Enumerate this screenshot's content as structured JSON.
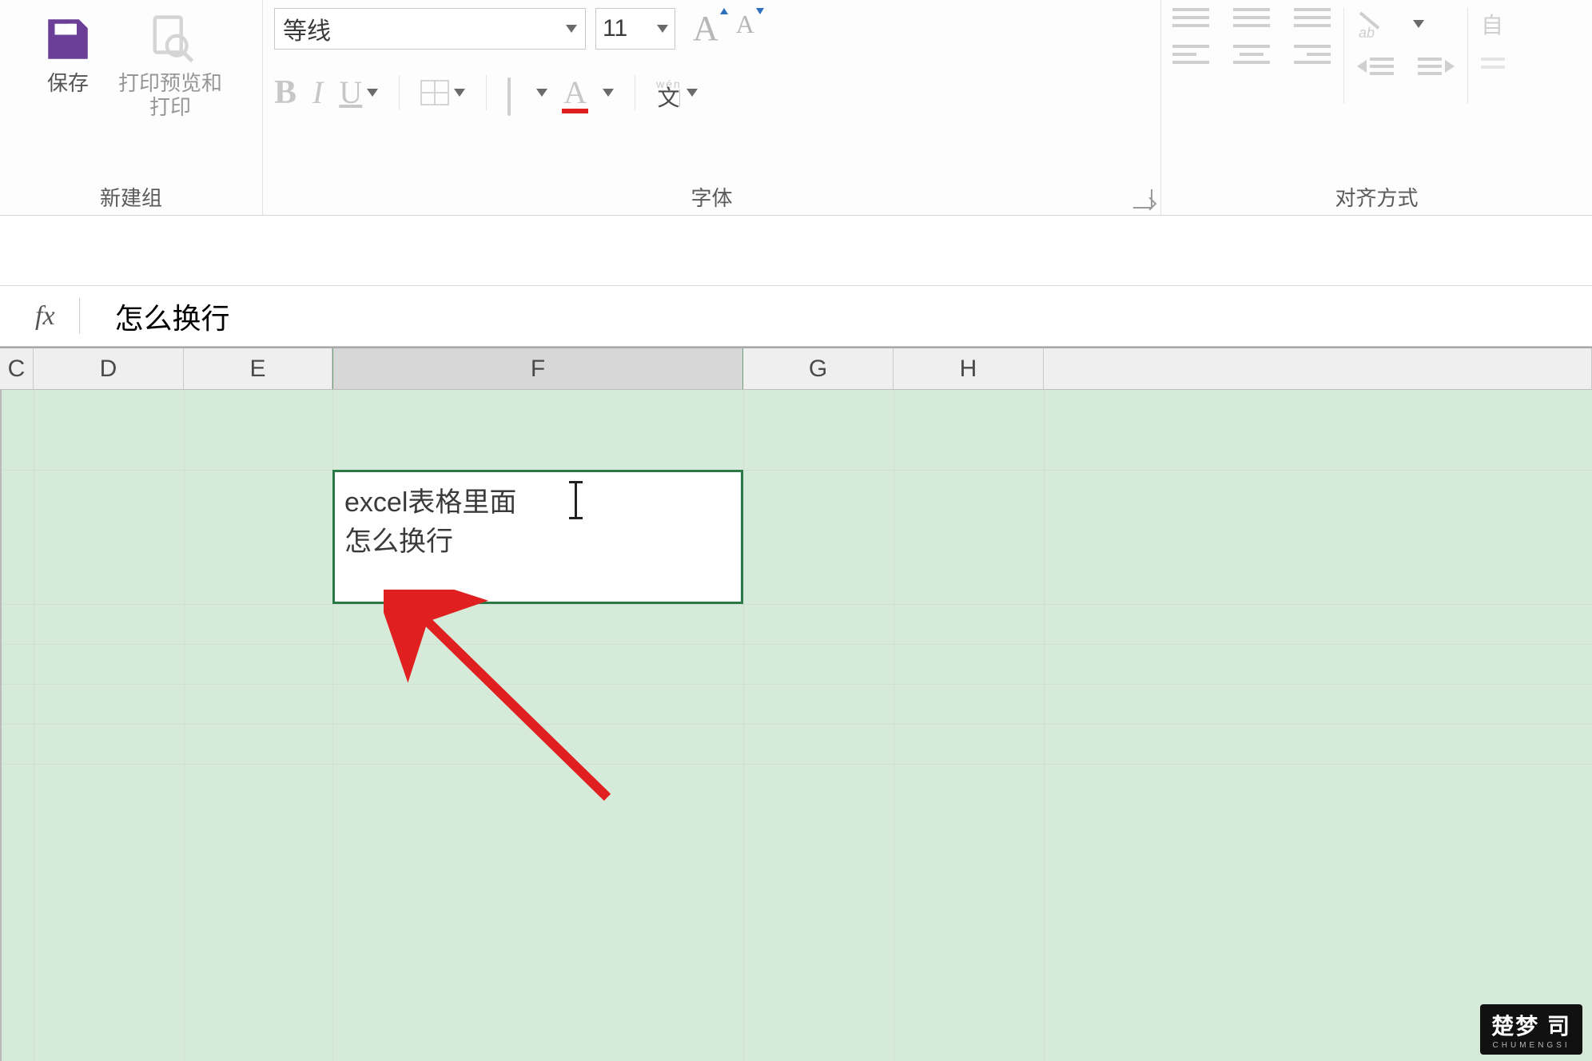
{
  "ribbon": {
    "new_group_label": "新建组",
    "save_label": "保存",
    "print_preview_label": "打印预览和\n打印",
    "font_group_label": "字体",
    "font_name": "等线",
    "font_size": "11",
    "bold_label": "B",
    "italic_label": "I",
    "underline_label": "U",
    "pinyin_top": "wén",
    "pinyin_bottom": "文",
    "align_group_label": "对齐方式",
    "wrap_hint": "自"
  },
  "formula_bar": {
    "fx": "fx",
    "value": " 怎么换行"
  },
  "columns": [
    "C",
    "D",
    "E",
    "F",
    "G",
    "H"
  ],
  "selected_column": "F",
  "cell": {
    "line1": "excel表格里面",
    "line2": "怎么换行"
  },
  "watermark": {
    "main": "楚梦 司",
    "sub": "CHUMENGSI"
  },
  "colors": {
    "accent_green": "#2a7a47",
    "sheet_bg": "#d6ead9",
    "red_underline": "#e02020",
    "save_purple": "#6b3f97"
  }
}
